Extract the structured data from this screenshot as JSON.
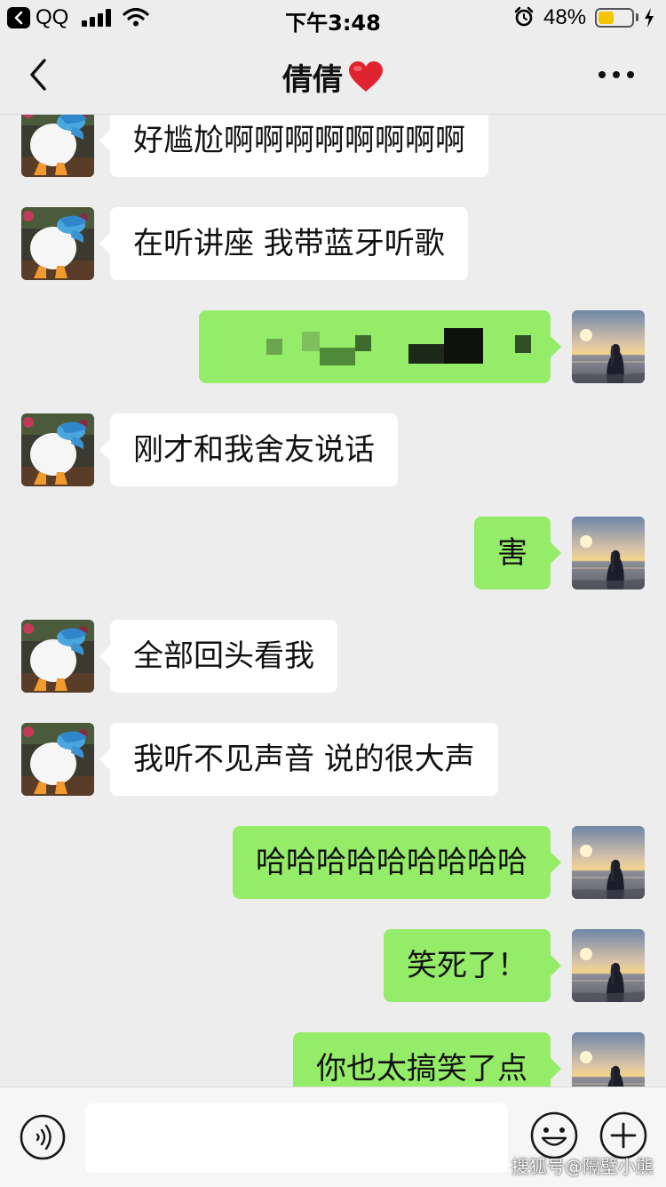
{
  "status_bar": {
    "carrier": "QQ",
    "time": "下午3:48",
    "battery_percent": "48%",
    "battery_level": 0.48,
    "icons": [
      "back-to-app-icon",
      "signal-icon",
      "wifi-icon",
      "alarm-icon",
      "battery-icon",
      "charging-icon"
    ]
  },
  "nav": {
    "title": "倩倩",
    "title_emoji": "heart-icon",
    "back_icon": "chevron-left-icon",
    "more_icon": "more-icon"
  },
  "messages": [
    {
      "side": "left",
      "text": "好尴尬啊啊啊啊啊啊啊啊"
    },
    {
      "side": "left",
      "text": "在听讲座 我带蓝牙听歌"
    },
    {
      "side": "right",
      "text": "",
      "censored": true
    },
    {
      "side": "left",
      "text": "刚才和我舍友说话"
    },
    {
      "side": "right",
      "text": "害"
    },
    {
      "side": "left",
      "text": "全部回头看我"
    },
    {
      "side": "left",
      "text": "我听不见声音 说的很大声"
    },
    {
      "side": "right",
      "text": "哈哈哈哈哈哈哈哈哈"
    },
    {
      "side": "right",
      "text": "笑死了！"
    },
    {
      "side": "right",
      "text": "你也太搞笑了点"
    }
  ],
  "input_bar": {
    "voice_icon": "voice-icon",
    "input_value": "",
    "emoji_icon": "emoji-icon",
    "plus_icon": "plus-icon"
  },
  "watermark": "搜狐号@隔壁小熊",
  "colors": {
    "background": "#ededed",
    "received_bubble": "#ffffff",
    "sent_bubble": "#95ec69",
    "battery_fill": "#f5c400"
  }
}
